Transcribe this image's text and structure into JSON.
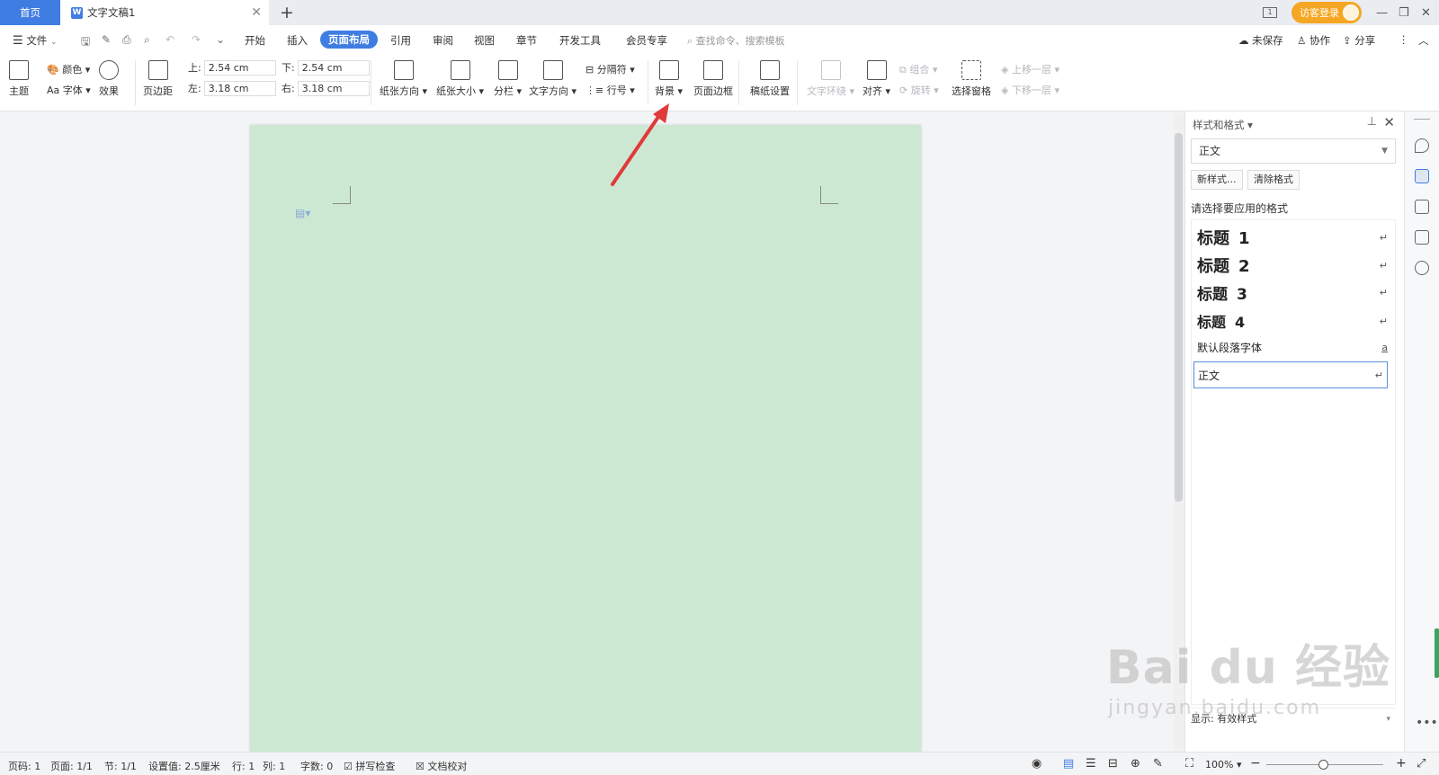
{
  "tabbar": {
    "home_tab": "首页",
    "doc_tab": "文字文稿1",
    "add_tab": "+",
    "visitor_login": "访客登录"
  },
  "menubar": {
    "file": "文件",
    "tabs": [
      "开始",
      "插入",
      "页面布局",
      "引用",
      "审阅",
      "视图",
      "章节",
      "开发工具",
      "会员专享"
    ],
    "active_tab": "页面布局",
    "search_placeholder": "查找命令、搜索模板",
    "unsaved": "未保存",
    "collaborate": "协作",
    "share": "分享"
  },
  "ribbon": {
    "theme": "主题",
    "colors": "颜色",
    "fonts": "Aa 字体",
    "effects": "效果",
    "margins": "页边距",
    "margin_top_label": "上:",
    "margin_top": "2.54 cm",
    "margin_bottom_label": "下:",
    "margin_bottom": "2.54 cm",
    "margin_left_label": "左:",
    "margin_left": "3.18 cm",
    "margin_right_label": "右:",
    "margin_right": "3.18 cm",
    "orientation": "纸张方向",
    "paper_size": "纸张大小",
    "columns": "分栏",
    "text_direction": "文字方向",
    "breaks": "分隔符",
    "line_numbers": "行号",
    "background": "背景",
    "page_border": "页面边框",
    "manuscript": "稿纸设置",
    "text_wrap": "文字环绕",
    "align": "对齐",
    "group": "组合",
    "rotate": "旋转",
    "selection_pane": "选择窗格",
    "bring_forward": "上移一层",
    "send_backward": "下移一层"
  },
  "pane": {
    "title": "样式和格式",
    "current_style": "正文",
    "new_style": "新样式...",
    "clear_format": "清除格式",
    "apply_label": "请选择要应用的格式",
    "styles": [
      {
        "name": "标题",
        "num": "1"
      },
      {
        "name": "标题",
        "num": "2"
      },
      {
        "name": "标题",
        "num": "3"
      },
      {
        "name": "标题",
        "num": "4"
      }
    ],
    "default_font": "默认段落字体",
    "body": "正文",
    "show_label": "显示:",
    "show_value": "有效样式"
  },
  "statusbar": {
    "page_num": "页码: 1",
    "pages": "页面: 1/1",
    "section": "节: 1/1",
    "setting": "设置值: 2.5厘米",
    "row": "行: 1",
    "col": "列: 1",
    "words": "字数: 0",
    "spell_check": "拼写检查",
    "doc_proof": "文档校对",
    "zoom": "100%"
  },
  "colors": {
    "accent": "#3f7de2",
    "page_background": "#cde8d2",
    "arrow": "#e03a3a",
    "visitor": "#f5a623"
  },
  "watermark": {
    "brand": "Bai du 经验",
    "url": "jingyan.baidu.com"
  }
}
